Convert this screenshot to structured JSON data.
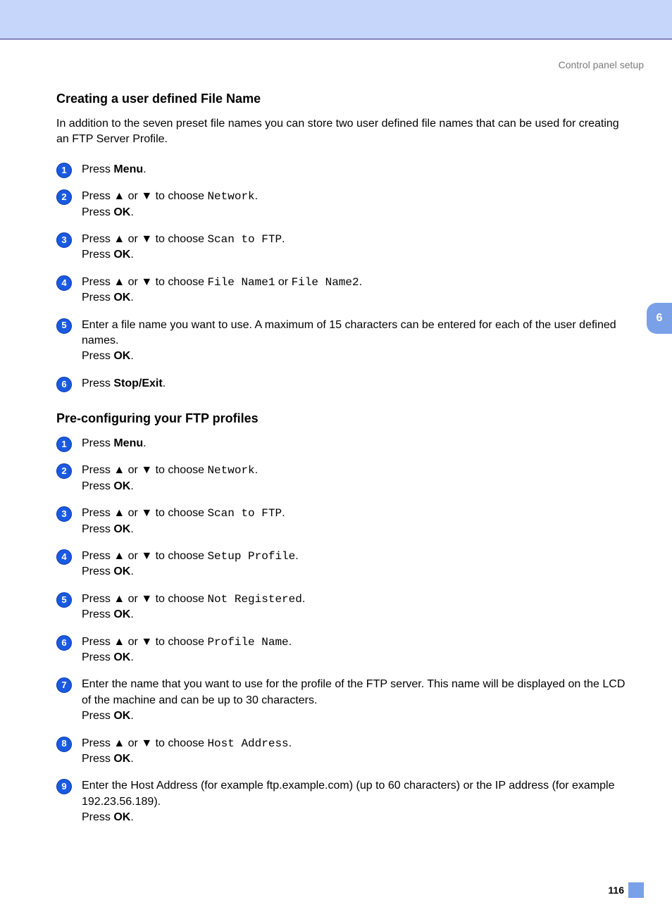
{
  "breadcrumb": "Control panel setup",
  "chapter_tab": "6",
  "page_number": "116",
  "text": {
    "press": "Press ",
    "press_ok_prefix": "Press ",
    "press_ok_bold": "OK",
    "menu": "Menu",
    "stop_exit": "Stop/Exit",
    "or": " or ",
    "to_choose": " to choose ",
    "period": ".",
    "up": "▲",
    "down": "▼"
  },
  "section1": {
    "heading": "Creating a user defined File Name",
    "intro": "In addition to the seven preset file names you can store two user defined file names that can be used for creating an FTP Server Profile.",
    "step2_choice": "Network",
    "step3_choice": "Scan to FTP",
    "step4_choice_a": "File Name1",
    "step4_or": " or ",
    "step4_choice_b": "File Name2",
    "step5_text": "Enter a file name you want to use. A maximum of 15 characters can be entered for each of the user defined names."
  },
  "section2": {
    "heading": "Pre-configuring your FTP profiles",
    "step2_choice": "Network",
    "step3_choice": "Scan to FTP",
    "step4_choice": "Setup Profile",
    "step5_choice": "Not Registered",
    "step6_choice": "Profile Name",
    "step7_text": "Enter the name that you want to use for the profile of the FTP server. This name will be displayed on the LCD of the machine and can be up to 30 characters.",
    "step8_choice": "Host Address",
    "step9_text": "Enter the Host Address (for example ftp.example.com) (up to 60 characters) or the IP address (for example 192.23.56.189)."
  }
}
